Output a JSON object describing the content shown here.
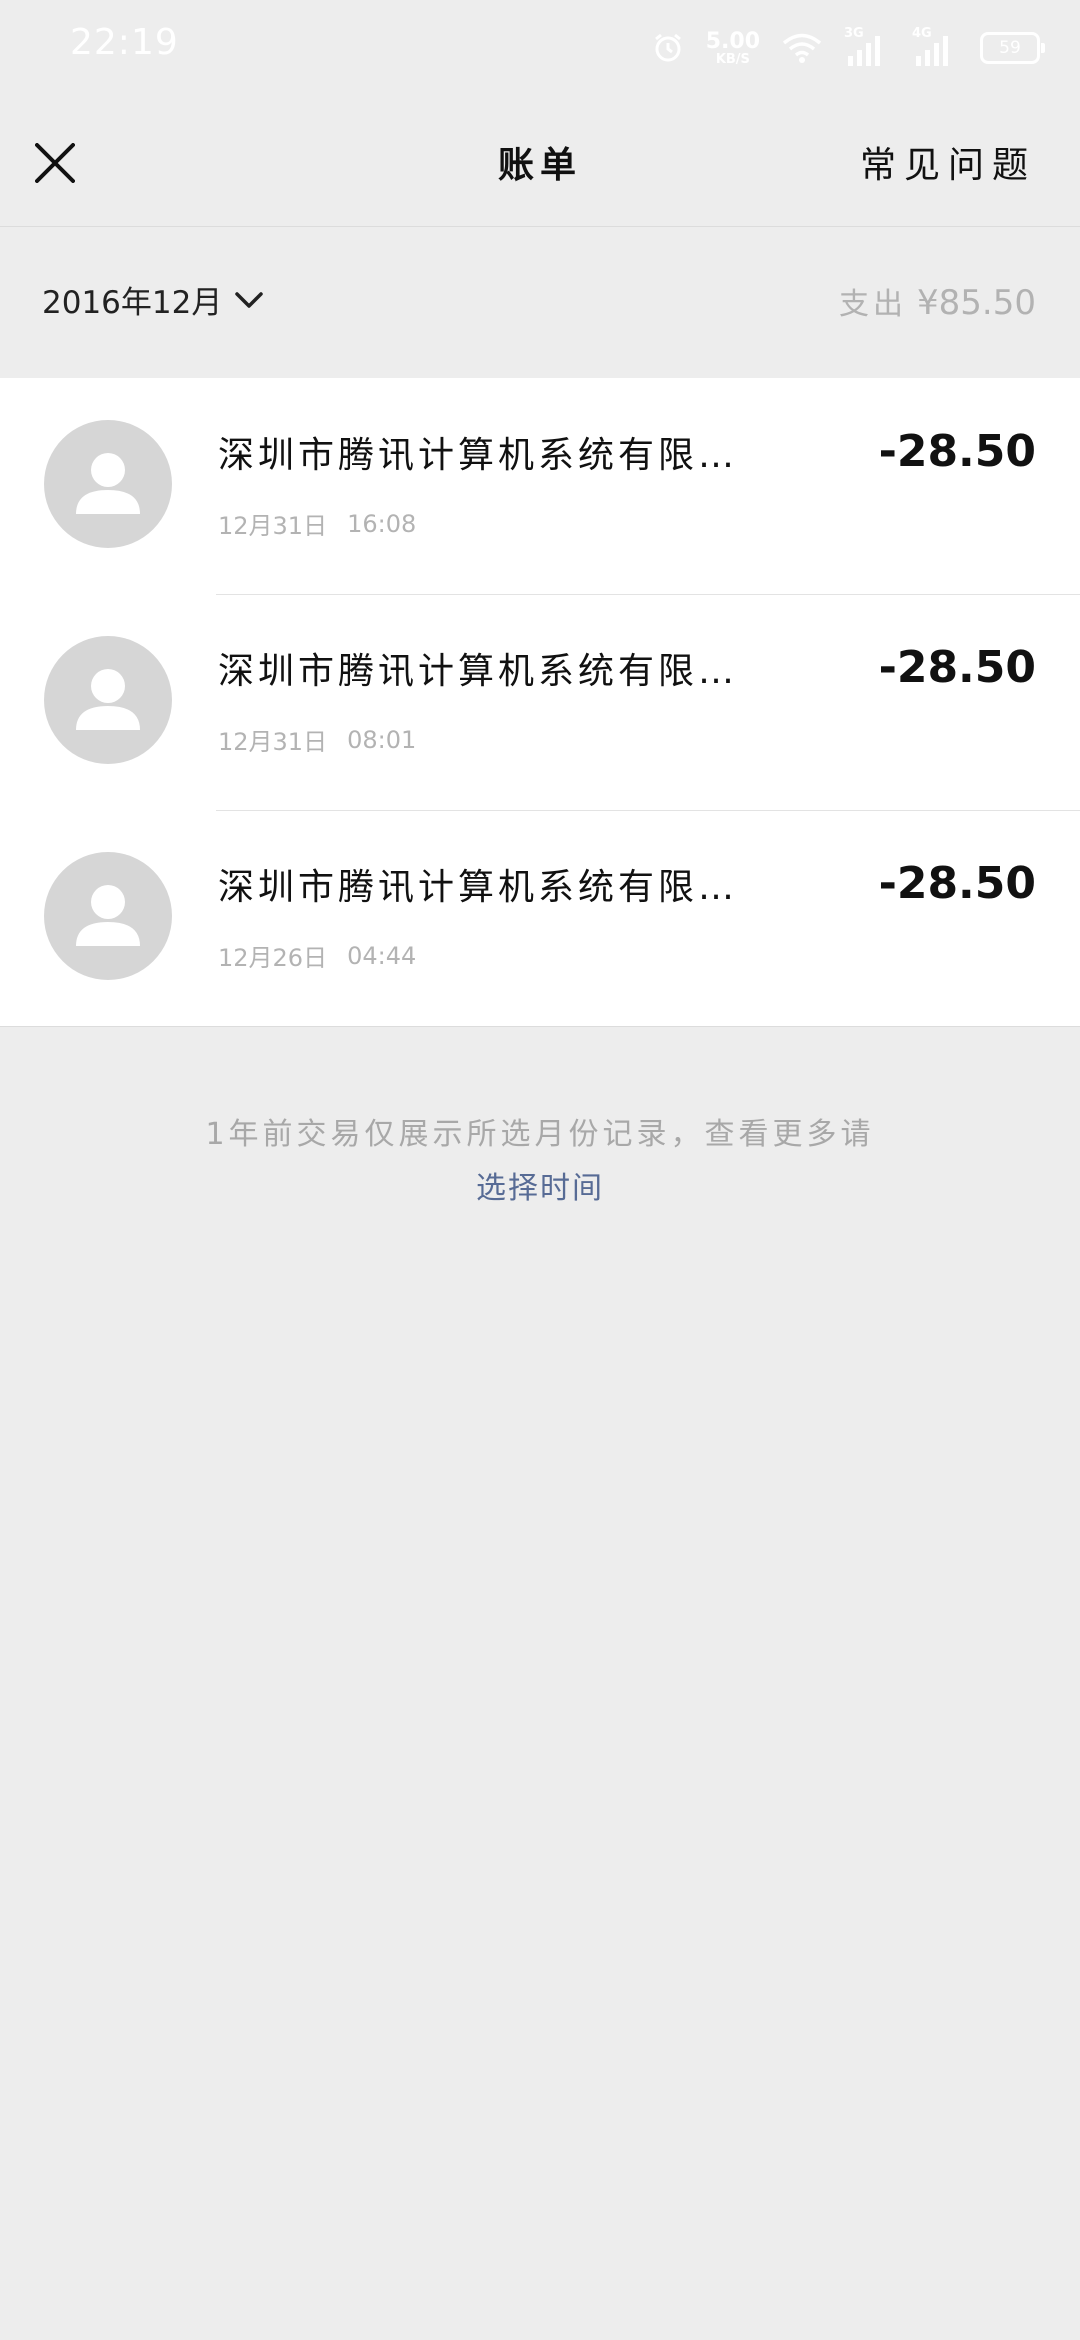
{
  "status_bar": {
    "time": "22:19",
    "net_speed": "5.00",
    "net_unit": "KB/S",
    "signal1_label": "3G",
    "signal2_label": "4G",
    "battery": "59"
  },
  "header": {
    "title": "账单",
    "faq": "常见问题"
  },
  "month_bar": {
    "month": "2016年12月",
    "expense_label": "支出",
    "expense_amount": "¥85.50"
  },
  "transactions": [
    {
      "merchant": "深圳市腾讯计算机系统有限…",
      "date": "12月31日",
      "time": "16:08",
      "amount": "-28.50"
    },
    {
      "merchant": "深圳市腾讯计算机系统有限…",
      "date": "12月31日",
      "time": "08:01",
      "amount": "-28.50"
    },
    {
      "merchant": "深圳市腾讯计算机系统有限…",
      "date": "12月26日",
      "time": "04:44",
      "amount": "-28.50"
    }
  ],
  "footer": {
    "note": "1年前交易仅展示所选月份记录，查看更多请",
    "link": "选择时间"
  },
  "colors": {
    "background": "#ededed",
    "link": "#576b95",
    "muted_text": "#b2b2b2",
    "avatar": "#d6d6d6"
  },
  "icons": [
    "alarm-icon",
    "wifi-icon",
    "signal-icon",
    "battery-icon",
    "close-icon",
    "chevron-down-icon",
    "default-avatar-icon"
  ]
}
